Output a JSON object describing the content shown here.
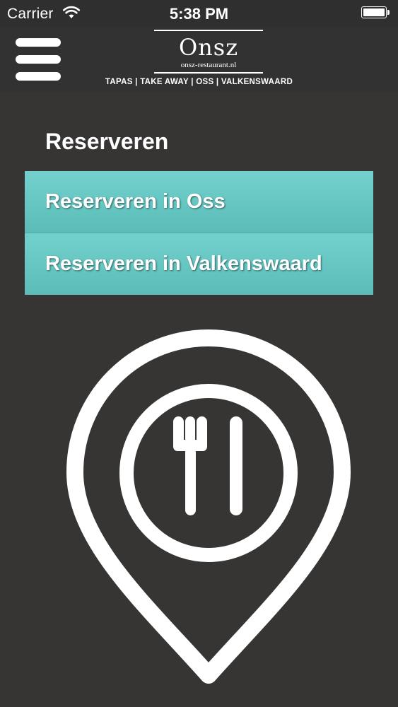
{
  "status_bar": {
    "carrier": "Carrier",
    "time": "5:38 PM",
    "icons": [
      "wifi-icon",
      "battery-icon"
    ]
  },
  "header": {
    "menu_icon": "hamburger-menu-icon",
    "logo_mark": "Onsz",
    "logo_url": "onsz-restaurant.nl",
    "tagline": "TAPAS | TAKE AWAY | OSS | VALKENSWAARD"
  },
  "main": {
    "title": "Reserveren",
    "items": [
      {
        "label": "Reserveren in Oss"
      },
      {
        "label": "Reserveren in Valkenswaard"
      }
    ],
    "illustration_icon": "restaurant-location-pin-icon"
  },
  "colors": {
    "background": "#373534",
    "accent": "#65c7c3",
    "text": "#ffffff"
  }
}
